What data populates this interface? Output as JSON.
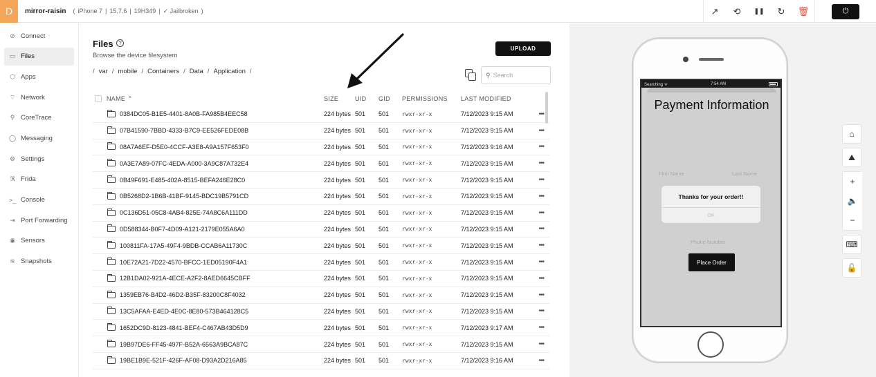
{
  "device": {
    "avatar_letter": "D",
    "name": "mirror-raisin",
    "model": "iPhone 7",
    "os_version": "15.7.6",
    "build": "19H349",
    "jailbreak_status": "✓ Jailbroken"
  },
  "top_actions": {
    "open_external_icon": "↗",
    "rotate_icon": "⟲",
    "pause_icon": "❚❚",
    "reload_icon": "↻",
    "delete_icon": "🗑",
    "power_icon": "⏻"
  },
  "sidebar": {
    "items": [
      {
        "label": "Connect",
        "icon": "⊘"
      },
      {
        "label": "Files",
        "icon": "▭"
      },
      {
        "label": "Apps",
        "icon": "⬡"
      },
      {
        "label": "Network",
        "icon": "⌔"
      },
      {
        "label": "CoreTrace",
        "icon": "⚲"
      },
      {
        "label": "Messaging",
        "icon": "◯"
      },
      {
        "label": "Settings",
        "icon": "⚙"
      },
      {
        "label": "Frida",
        "icon": "ℜ"
      },
      {
        "label": "Console",
        "icon": ">_"
      },
      {
        "label": "Port Forwarding",
        "icon": "⇥"
      },
      {
        "label": "Sensors",
        "icon": "◉"
      },
      {
        "label": "Snapshots",
        "icon": "≋"
      }
    ],
    "active_index": 1
  },
  "files": {
    "title": "Files",
    "help_icon": "?",
    "subtitle": "Browse the device filesystem",
    "upload_label": "UPLOAD",
    "breadcrumb": [
      "/",
      "var",
      "/",
      "mobile",
      "/",
      "Containers",
      "/",
      "Data",
      "/",
      "Application",
      "/"
    ],
    "search_placeholder": "Search",
    "search_icon": "⚲",
    "columns": {
      "name": "NAME ⌃",
      "size": "SIZE",
      "uid": "UID",
      "gid": "GID",
      "permissions": "PERMISSIONS",
      "modified": "LAST MODIFIED"
    },
    "rows": [
      {
        "name": "0384DC05-B1E5-4401-8A0B-FA985B4EEC58",
        "size": "224 bytes",
        "uid": "501",
        "gid": "501",
        "perm": "rwxr-xr-x",
        "modified": "7/12/2023 9:15 AM"
      },
      {
        "name": "07B41590-7BBD-4333-B7C9-EE526FEDE08B",
        "size": "224 bytes",
        "uid": "501",
        "gid": "501",
        "perm": "rwxr-xr-x",
        "modified": "7/12/2023 9:15 AM"
      },
      {
        "name": "08A7A6EF-D5E0-4CCF-A3E8-A9A157F653F0",
        "size": "224 bytes",
        "uid": "501",
        "gid": "501",
        "perm": "rwxr-xr-x",
        "modified": "7/12/2023 9:16 AM"
      },
      {
        "name": "0A3E7A89-07FC-4EDA-A000-3A9C87A732E4",
        "size": "224 bytes",
        "uid": "501",
        "gid": "501",
        "perm": "rwxr-xr-x",
        "modified": "7/12/2023 9:15 AM"
      },
      {
        "name": "0B49F691-E485-402A-8515-BEFA246E28C0",
        "size": "224 bytes",
        "uid": "501",
        "gid": "501",
        "perm": "rwxr-xr-x",
        "modified": "7/12/2023 9:15 AM"
      },
      {
        "name": "0B5268D2-1B6B-41BF-9145-BDC19B5791CD",
        "size": "224 bytes",
        "uid": "501",
        "gid": "501",
        "perm": "rwxr-xr-x",
        "modified": "7/12/2023 9:15 AM"
      },
      {
        "name": "0C136D51-05C8-4AB4-825E-74A8C6A111DD",
        "size": "224 bytes",
        "uid": "501",
        "gid": "501",
        "perm": "rwxr-xr-x",
        "modified": "7/12/2023 9:15 AM"
      },
      {
        "name": "0D588344-B0F7-4D09-A121-2179E055A6A0",
        "size": "224 bytes",
        "uid": "501",
        "gid": "501",
        "perm": "rwxr-xr-x",
        "modified": "7/12/2023 9:15 AM"
      },
      {
        "name": "100811FA-17A5-49F4-9BDB-CCAB6A11730C",
        "size": "224 bytes",
        "uid": "501",
        "gid": "501",
        "perm": "rwxr-xr-x",
        "modified": "7/12/2023 9:15 AM"
      },
      {
        "name": "10E72A21-7D22-4570-BFCC-1ED05190F4A1",
        "size": "224 bytes",
        "uid": "501",
        "gid": "501",
        "perm": "rwxr-xr-x",
        "modified": "7/12/2023 9:15 AM"
      },
      {
        "name": "12B1DA02-921A-4ECE-A2F2-8AED6645CBFF",
        "size": "224 bytes",
        "uid": "501",
        "gid": "501",
        "perm": "rwxr-xr-x",
        "modified": "7/12/2023 9:15 AM"
      },
      {
        "name": "1359EB76-B4D2-46D2-B35F-83200C8F4032",
        "size": "224 bytes",
        "uid": "501",
        "gid": "501",
        "perm": "rwxr-xr-x",
        "modified": "7/12/2023 9:15 AM"
      },
      {
        "name": "13C5AFAA-E4ED-4E0C-8E80-573B464128C5",
        "size": "224 bytes",
        "uid": "501",
        "gid": "501",
        "perm": "rwxr-xr-x",
        "modified": "7/12/2023 9:15 AM"
      },
      {
        "name": "1652DC9D-8123-4841-BEF4-C467AB43D5D9",
        "size": "224 bytes",
        "uid": "501",
        "gid": "501",
        "perm": "rwxr-xr-x",
        "modified": "7/12/2023 9:17 AM"
      },
      {
        "name": "19B97DE6-FF45-497F-B52A-6563A9BCA87C",
        "size": "224 bytes",
        "uid": "501",
        "gid": "501",
        "perm": "rwxr-xr-x",
        "modified": "7/12/2023 9:15 AM"
      },
      {
        "name": "19BE1B9E-521F-426F-AF08-D93A2D216A85",
        "size": "224 bytes",
        "uid": "501",
        "gid": "501",
        "perm": "rwxr-xr-x",
        "modified": "7/12/2023 9:16 AM"
      }
    ],
    "more_icon": "•••"
  },
  "phone": {
    "status_carrier": "Searching ᯤ",
    "status_time": "7:54 AM",
    "screen_title": "Payment Information",
    "first_name_placeholder": "First Name",
    "last_name_placeholder": "Last Name",
    "phone_placeholder": "Phone Number",
    "alert_message": "Thanks for your order!!",
    "alert_ok": "OK",
    "place_order_label": "Place Order"
  },
  "device_tools": {
    "home_icon": "⌂",
    "screenshot_icon": "⛰",
    "volume_up_icon": "+",
    "volume_icon": "🔈",
    "volume_down_icon": "−",
    "keyboard_icon": "⌨",
    "lock_icon": "🔓"
  }
}
